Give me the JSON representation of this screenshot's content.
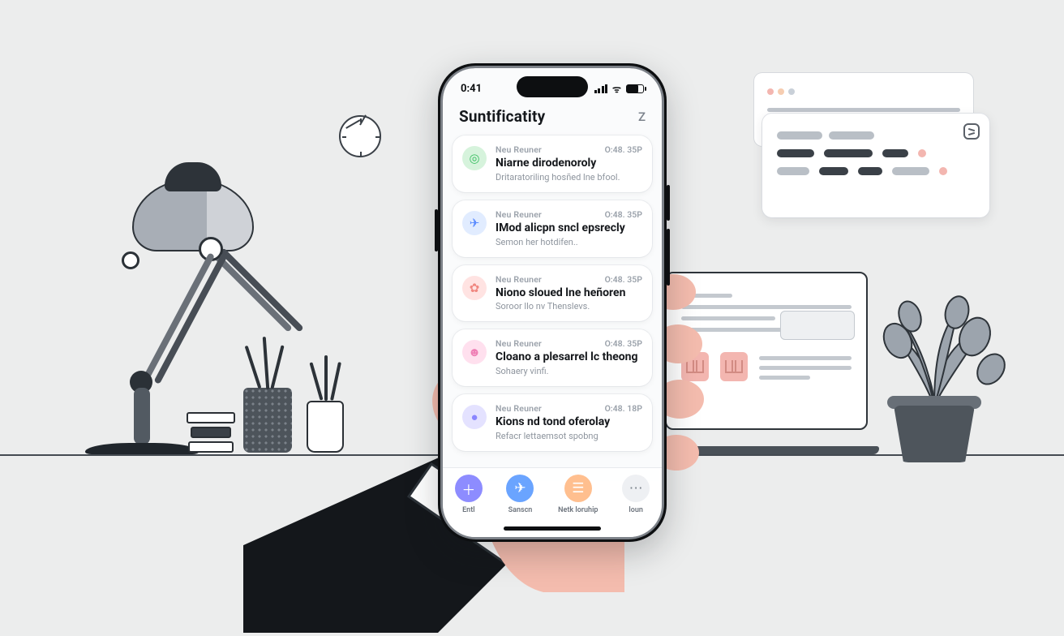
{
  "statusbar": {
    "time": "0:41"
  },
  "header": {
    "title": "Suntificatity",
    "action": "Z"
  },
  "notification_label": "Neu Reuner",
  "notifications": [
    {
      "icon_color": "green",
      "icon_glyph": "◎",
      "time": "O:48. 35P",
      "title": "Niarne dirodenoroly",
      "subtitle": "Dritaratoriling hosñed lne bfool."
    },
    {
      "icon_color": "blue",
      "icon_glyph": "✈",
      "time": "O:48. 35P",
      "title": "IMod alicpn sncl epsrecly",
      "subtitle": "Semon her hotdifen.."
    },
    {
      "icon_color": "pink",
      "icon_glyph": "✿",
      "time": "O:48. 35P",
      "title": "Niono sloued lne heñoren",
      "subtitle": "Soroor llo nv Thenslevs."
    },
    {
      "icon_color": "rose",
      "icon_glyph": "☻",
      "time": "O:48. 35P",
      "title": "Cloano a plesarrel lc theong",
      "subtitle": "Sohaery vinfi."
    },
    {
      "icon_color": "purple",
      "icon_glyph": "●",
      "time": "O:48. 18P",
      "title": "Kions nd tond oferolay",
      "subtitle": "Refacr lettaemsot spobng"
    }
  ],
  "tabs": [
    {
      "glyph": "＋",
      "label": "Entl"
    },
    {
      "glyph": "✈",
      "label": "Sanscn"
    },
    {
      "glyph": "☰",
      "label": "Netk loruhip"
    },
    {
      "glyph": "⋯",
      "label": "loun"
    }
  ]
}
